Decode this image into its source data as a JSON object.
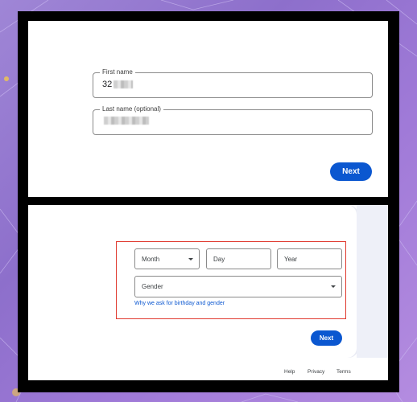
{
  "name_step": {
    "first_name": {
      "label": "First name",
      "value": "32"
    },
    "last_name": {
      "label": "Last name (optional)",
      "value": ""
    },
    "next_label": "Next"
  },
  "birthday_step": {
    "month": {
      "placeholder": "Month"
    },
    "day": {
      "placeholder": "Day"
    },
    "year": {
      "placeholder": "Year"
    },
    "gender": {
      "placeholder": "Gender"
    },
    "why_link": "Why we ask for birthday and gender",
    "next_label": "Next"
  },
  "footer": {
    "help": "Help",
    "privacy": "Privacy",
    "terms": "Terms"
  },
  "colors": {
    "accent": "#0b57d0",
    "highlight": "#e03a2f",
    "frame": "#000000"
  }
}
